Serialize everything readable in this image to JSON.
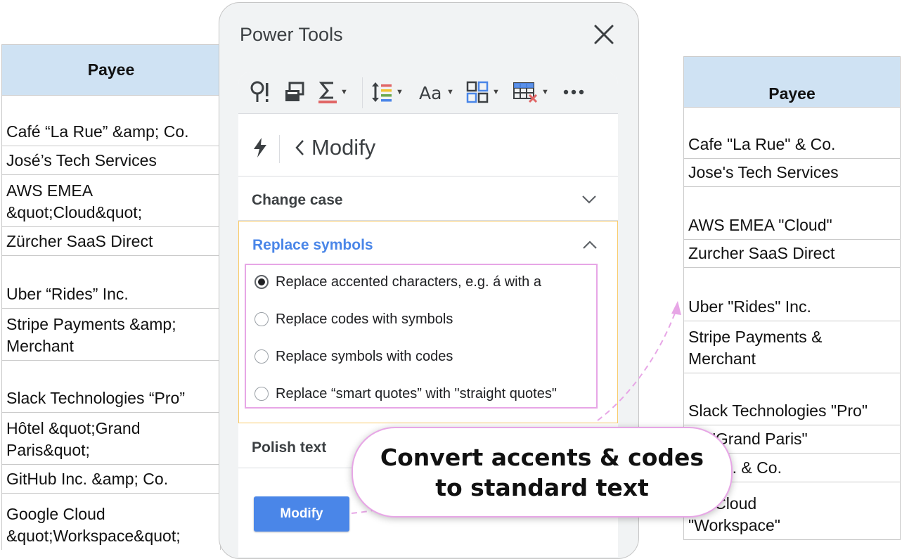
{
  "left_sheet": {
    "header": "Payee",
    "rows": [
      "Café “La Rue” &amp; Co.",
      "José’s Tech Services",
      "AWS EMEA\n&quot;Cloud&quot;",
      "Zürcher SaaS Direct",
      "Uber “Rides” Inc.",
      "Stripe Payments &amp;\nMerchant",
      "Slack Technologies “Pro”",
      "Hôtel &quot;Grand\nParis&quot;",
      "GitHub Inc. &amp; Co.",
      "Google Cloud\n&quot;Workspace&quot;"
    ]
  },
  "right_sheet": {
    "header": "Payee",
    "rows": [
      "Cafe \"La Rue\" & Co.",
      "Jose's Tech Services",
      "AWS EMEA \"Cloud\"",
      "Zurcher SaaS Direct",
      "Uber \"Rides\" Inc.",
      "Stripe Payments &\nMerchant",
      "Slack Technologies \"Pro\"",
      "tel \"Grand Paris\"",
      "ub Inc. & Co.",
      "gle Cloud\n\"Workspace\""
    ]
  },
  "panel": {
    "title": "Power Tools",
    "back_label": "Modify",
    "sections": {
      "change_case": "Change case",
      "replace_symbols": "Replace symbols",
      "polish_text": "Polish text"
    },
    "options": [
      "Replace accented characters, e.g. á with a",
      "Replace codes with symbols",
      "Replace symbols with codes",
      "Replace “smart quotes” with \"straight quotes\""
    ],
    "selected_option": 0,
    "modify_button": "Modify"
  },
  "callout": {
    "line1": "Convert accents & codes",
    "line2": "to standard text"
  },
  "colors": {
    "header_fill": "#cfe2f3",
    "accent_blue": "#4a86e8",
    "highlight_pink": "#e7a6e6",
    "active_section_border": "#f9cb6b",
    "sum_underline": "#e06666"
  },
  "icons": [
    "find-icon",
    "copy-sheet-icon",
    "sum-icon",
    "line-spacing-icon",
    "text-case-icon",
    "grid-icon",
    "remove-columns-icon",
    "more-icon",
    "flash-icon",
    "chevron-left-icon",
    "chevron-down-icon",
    "chevron-up-icon",
    "close-icon"
  ]
}
